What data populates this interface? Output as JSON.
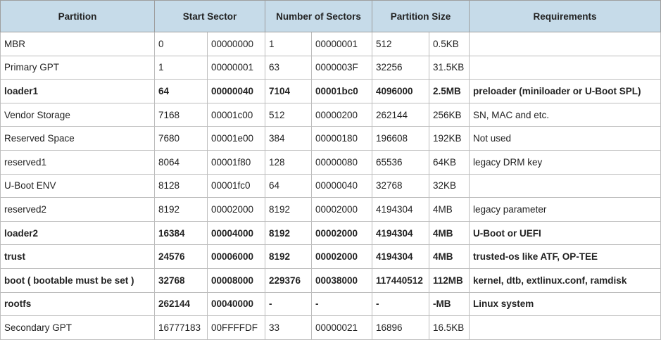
{
  "header": {
    "partition": "Partition",
    "start_sector": "Start Sector",
    "number_of_sectors": "Number of Sectors",
    "partition_size": "Partition Size",
    "requirements": "Requirements"
  },
  "rows": [
    {
      "partition": "MBR",
      "start_dec": "0",
      "start_hex": "00000000",
      "num_dec": "1",
      "num_hex": "00000001",
      "size_bytes": "512",
      "size_h": "0.5KB",
      "requirements": "",
      "bold": false
    },
    {
      "partition": "Primary GPT",
      "start_dec": "1",
      "start_hex": "00000001",
      "num_dec": "63",
      "num_hex": "0000003F",
      "size_bytes": "32256",
      "size_h": "31.5KB",
      "requirements": "",
      "bold": false
    },
    {
      "partition": "loader1",
      "start_dec": "64",
      "start_hex": "00000040",
      "num_dec": "7104",
      "num_hex": "00001bc0",
      "size_bytes": "4096000",
      "size_h": "2.5MB",
      "requirements": "preloader (miniloader or U-Boot SPL)",
      "bold": true
    },
    {
      "partition": "Vendor Storage",
      "start_dec": "7168",
      "start_hex": "00001c00",
      "num_dec": "512",
      "num_hex": "00000200",
      "size_bytes": "262144",
      "size_h": "256KB",
      "requirements": "SN, MAC and etc.",
      "bold": false
    },
    {
      "partition": "Reserved Space",
      "start_dec": "7680",
      "start_hex": "00001e00",
      "num_dec": "384",
      "num_hex": "00000180",
      "size_bytes": "196608",
      "size_h": "192KB",
      "requirements": "Not used",
      "bold": false
    },
    {
      "partition": "reserved1",
      "start_dec": "8064",
      "start_hex": "00001f80",
      "num_dec": "128",
      "num_hex": "00000080",
      "size_bytes": "65536",
      "size_h": "64KB",
      "requirements": "legacy DRM key",
      "bold": false
    },
    {
      "partition": "U-Boot ENV",
      "start_dec": "8128",
      "start_hex": "00001fc0",
      "num_dec": "64",
      "num_hex": "00000040",
      "size_bytes": "32768",
      "size_h": "32KB",
      "requirements": "",
      "bold": false
    },
    {
      "partition": "reserved2",
      "start_dec": "8192",
      "start_hex": "00002000",
      "num_dec": "8192",
      "num_hex": "00002000",
      "size_bytes": "4194304",
      "size_h": "4MB",
      "requirements": "legacy parameter",
      "bold": false
    },
    {
      "partition": "loader2",
      "start_dec": "16384",
      "start_hex": "00004000",
      "num_dec": "8192",
      "num_hex": "00002000",
      "size_bytes": "4194304",
      "size_h": "4MB",
      "requirements": "U-Boot or UEFI",
      "bold": true
    },
    {
      "partition": "trust",
      "start_dec": "24576",
      "start_hex": "00006000",
      "num_dec": "8192",
      "num_hex": "00002000",
      "size_bytes": "4194304",
      "size_h": "4MB",
      "requirements": "trusted-os like ATF, OP-TEE",
      "bold": true
    },
    {
      "partition": "boot ( bootable must be set )",
      "start_dec": "32768",
      "start_hex": "00008000",
      "num_dec": "229376",
      "num_hex": "00038000",
      "size_bytes": "117440512",
      "size_h": "112MB",
      "requirements": "kernel, dtb, extlinux.conf, ramdisk",
      "bold": true
    },
    {
      "partition": "rootfs",
      "start_dec": "262144",
      "start_hex": "00040000",
      "num_dec": "-",
      "num_hex": "-",
      "size_bytes": "-",
      "size_h": "-MB",
      "requirements": "Linux system",
      "bold": true
    },
    {
      "partition": "Secondary GPT",
      "start_dec": "16777183",
      "start_hex": "00FFFFDF",
      "num_dec": "33",
      "num_hex": "00000021",
      "size_bytes": "16896",
      "size_h": "16.5KB",
      "requirements": "",
      "bold": false
    }
  ]
}
